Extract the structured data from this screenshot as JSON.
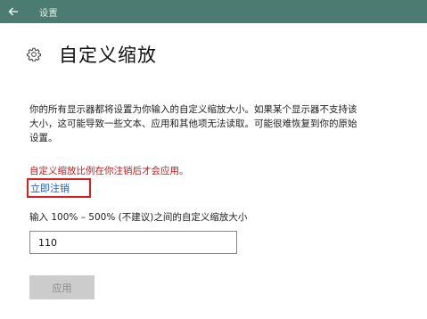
{
  "window": {
    "title": "设置",
    "back_icon": "back-arrow-icon",
    "titlebar_color": "#4c7b71"
  },
  "page": {
    "icon": "gear-icon",
    "title": "自定义缩放",
    "description": "你的所有显示器都将设置为你输入的自定义缩放大小。如果某个显示器不支持该大小，这可能导致一些文本、应用和其他项无法读取。可能很难恢复到你的原始设置。",
    "warning": "自定义缩放比例在你注销后才会应用。",
    "warning_color": "#c01a1a",
    "signout_link": "立即注销",
    "link_color": "#1d5fbf",
    "input_label": "输入 100% – 500% (不建议)之间的自定义缩放大小",
    "input_value": "110",
    "apply_button": "应用",
    "apply_button_state": "disabled"
  }
}
